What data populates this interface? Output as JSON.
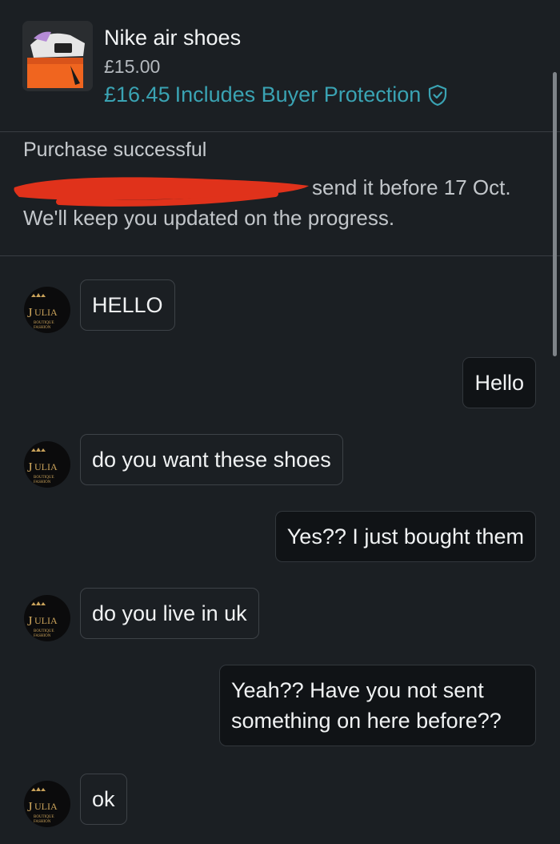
{
  "product": {
    "title": "Nike air shoes",
    "price": "£15.00",
    "total": "£16.45",
    "protection": "Includes Buyer Protection",
    "thumbnail_icon": "shoe-box-image",
    "accent_color": "#3aa3b3"
  },
  "notice": {
    "title": "Purchase successful",
    "line1_visible": "send it before 17 Oct.",
    "line2": "We'll keep you updated on the progress."
  },
  "avatar": {
    "brand_top": "JULIA",
    "brand_sub1": "BOUTIQUE",
    "brand_sub2": "FASHION"
  },
  "messages": [
    {
      "from": "seller",
      "text": "HELLO"
    },
    {
      "from": "me",
      "text": "Hello"
    },
    {
      "from": "seller",
      "text": "do you want these shoes"
    },
    {
      "from": "me",
      "text": "Yes?? I just bought them"
    },
    {
      "from": "seller",
      "text": "do you live in uk"
    },
    {
      "from": "me",
      "text": "Yeah?? Have you not sent something on here before??"
    },
    {
      "from": "seller",
      "text": "ok"
    }
  ]
}
